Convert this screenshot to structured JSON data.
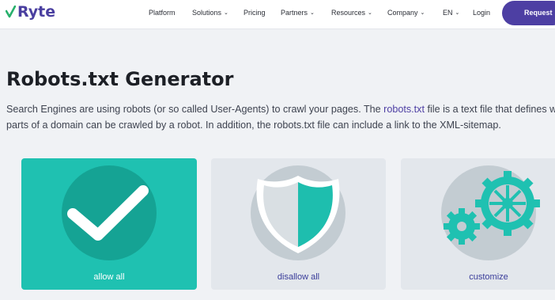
{
  "brand": {
    "logo_text": "Ryte",
    "colors": {
      "primary": "#4d3fa3",
      "teal": "#1fc1b1",
      "green_check": "#27b06c"
    }
  },
  "nav": {
    "items": [
      {
        "label": "Platform",
        "has_dropdown": false
      },
      {
        "label": "Solutions",
        "has_dropdown": true
      },
      {
        "label": "Pricing",
        "has_dropdown": false
      },
      {
        "label": "Partners",
        "has_dropdown": true
      },
      {
        "label": "Resources",
        "has_dropdown": true
      },
      {
        "label": "Company",
        "has_dropdown": true
      },
      {
        "label": "EN",
        "has_dropdown": true
      },
      {
        "label": "Login",
        "has_dropdown": false
      }
    ],
    "cta_label": "Request"
  },
  "page": {
    "title": "Robots.txt Generator",
    "description_part1": "Search Engines are using robots (or so called User-Agents) to crawl your pages. The ",
    "description_link": "robots.txt",
    "description_part2": " file is a text file that defines which",
    "description_line2": "parts of a domain can be crawled by a robot. In addition, the robots.txt file can include a link to the XML-sitemap."
  },
  "options": [
    {
      "label": "allow all",
      "icon": "checkmark-icon",
      "selected": true
    },
    {
      "label": "disallow all",
      "icon": "shield-icon",
      "selected": false
    },
    {
      "label": "customize",
      "icon": "gears-icon",
      "selected": false
    }
  ]
}
